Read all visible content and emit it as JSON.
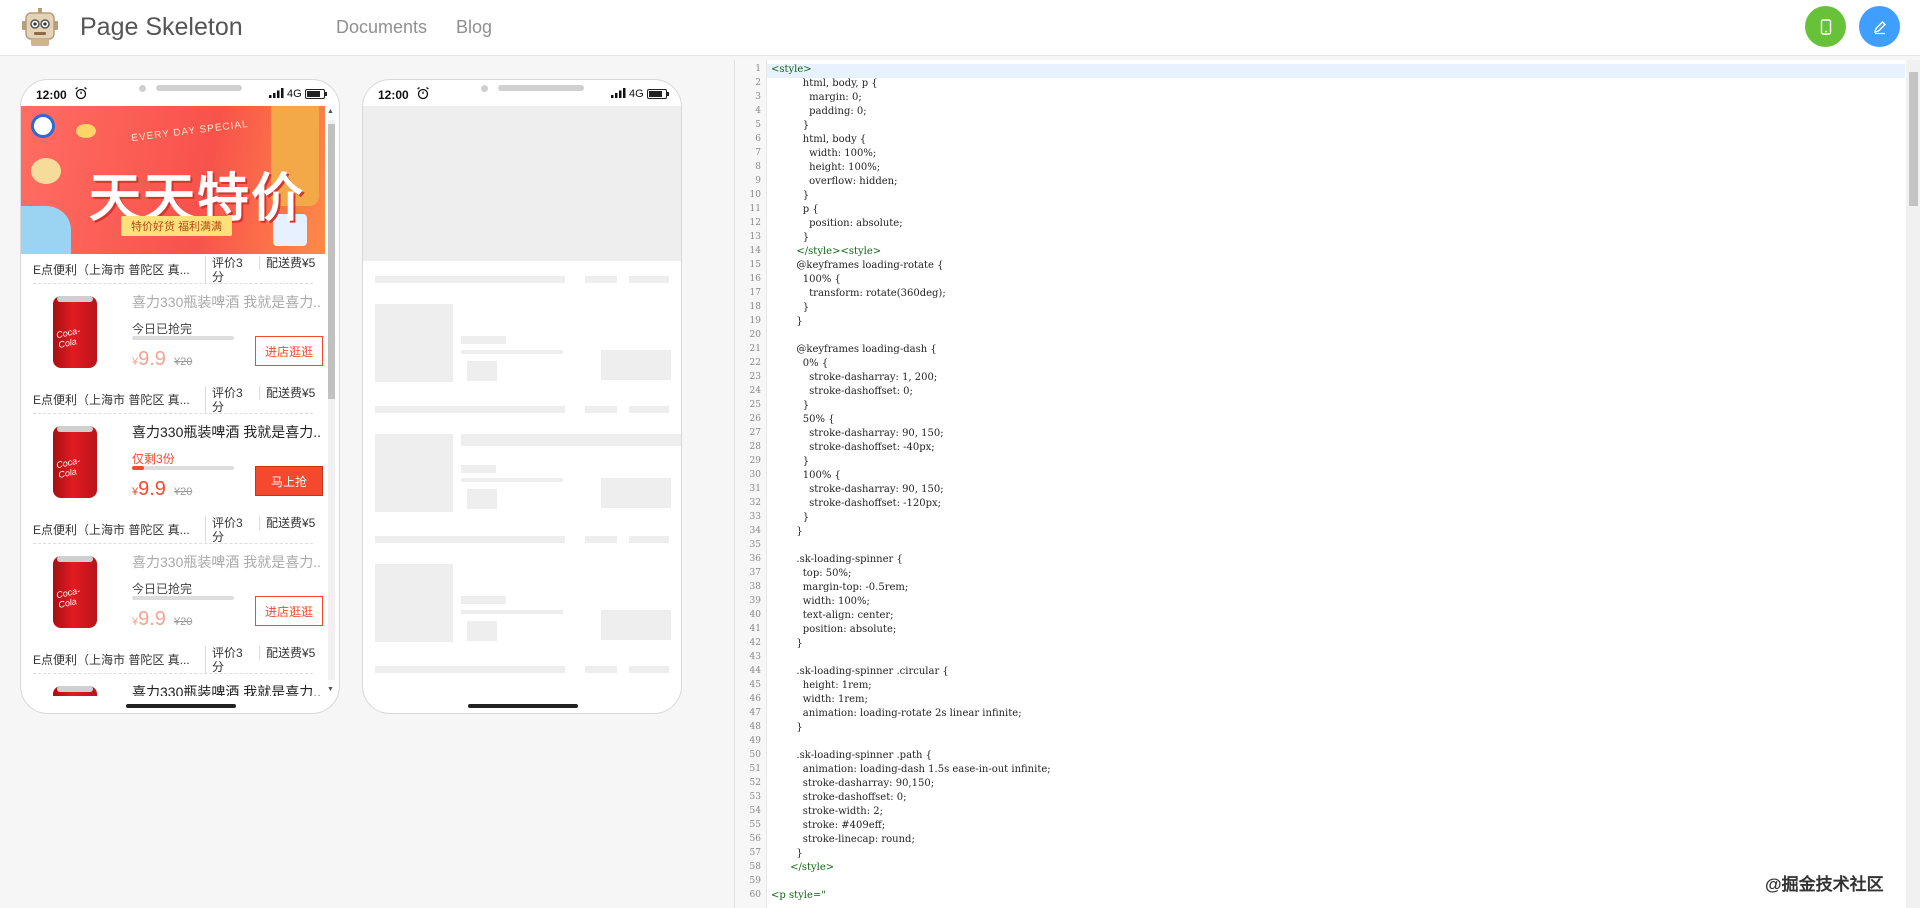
{
  "header": {
    "brand": "Page Skeleton",
    "nav": [
      "Documents",
      "Blog"
    ],
    "colors": {
      "green_button": "#67c23a",
      "blue_button": "#409eff"
    },
    "icons": [
      "robot-logo-icon",
      "mobile-icon",
      "edit-icon"
    ]
  },
  "phone": {
    "time": "12:00",
    "network": "4G"
  },
  "banner": {
    "top_text": "EVERY DAY SPECIAL",
    "title": "天天特价",
    "tags": "特价好货  福利满满"
  },
  "store": {
    "name": "E点便利（上海市 普陀区 真...",
    "rating": "评价3分",
    "fee": "配送费¥5"
  },
  "products": [
    {
      "title": "喜力330瓶装啤酒 我就是喜力...",
      "status": "今日已抢完",
      "price": "9.9",
      "currency": "¥",
      "old_price": "¥20",
      "button": "进店逛逛",
      "sold_out": true,
      "progress": 0
    },
    {
      "title": "喜力330瓶装啤酒 我就是喜力...",
      "status": "仅剩3份",
      "price": "9.9",
      "currency": "¥",
      "old_price": "¥20",
      "button": "马上抢",
      "sold_out": false,
      "progress": 0.12
    },
    {
      "title": "喜力330瓶装啤酒 我就是喜力...",
      "status": "今日已抢完",
      "price": "9.9",
      "currency": "¥",
      "old_price": "¥20",
      "button": "进店逛逛",
      "sold_out": true,
      "progress": 0
    }
  ],
  "partial_title": "喜力330瓶装啤酒 我就是喜力...",
  "can_label": "Coca-Cola",
  "code_lines": [
    "<style>",
    "          html, body, p {",
    "            margin: 0;",
    "            padding: 0;",
    "          }",
    "          html, body {",
    "            width: 100%;",
    "            height: 100%;",
    "            overflow: hidden;",
    "          }",
    "          p {",
    "            position: absolute;",
    "          }",
    "        </style><style>",
    "        @keyframes loading-rotate {",
    "          100% {",
    "            transform: rotate(360deg);",
    "          }",
    "        }",
    "",
    "        @keyframes loading-dash {",
    "          0% {",
    "            stroke-dasharray: 1, 200;",
    "            stroke-dashoffset: 0;",
    "          }",
    "          50% {",
    "            stroke-dasharray: 90, 150;",
    "            stroke-dashoffset: -40px;",
    "          }",
    "          100% {",
    "            stroke-dasharray: 90, 150;",
    "            stroke-dashoffset: -120px;",
    "          }",
    "        }",
    "",
    "        .sk-loading-spinner {",
    "          top: 50%;",
    "          margin-top: -0.5rem;",
    "          width: 100%;",
    "          text-align: center;",
    "          position: absolute;",
    "        }",
    "",
    "        .sk-loading-spinner .circular {",
    "          height: 1rem;",
    "          width: 1rem;",
    "          animation: loading-rotate 2s linear infinite;",
    "        }",
    "",
    "        .sk-loading-spinner .path {",
    "          animation: loading-dash 1.5s ease-in-out infinite;",
    "          stroke-dasharray: 90,150;",
    "          stroke-dashoffset: 0;",
    "          stroke-width: 2;",
    "          stroke: #409eff;",
    "          stroke-linecap: round;",
    "        }",
    "      </style>",
    "",
    "<p style=\""
  ],
  "watermark": "@掘金技术社区"
}
